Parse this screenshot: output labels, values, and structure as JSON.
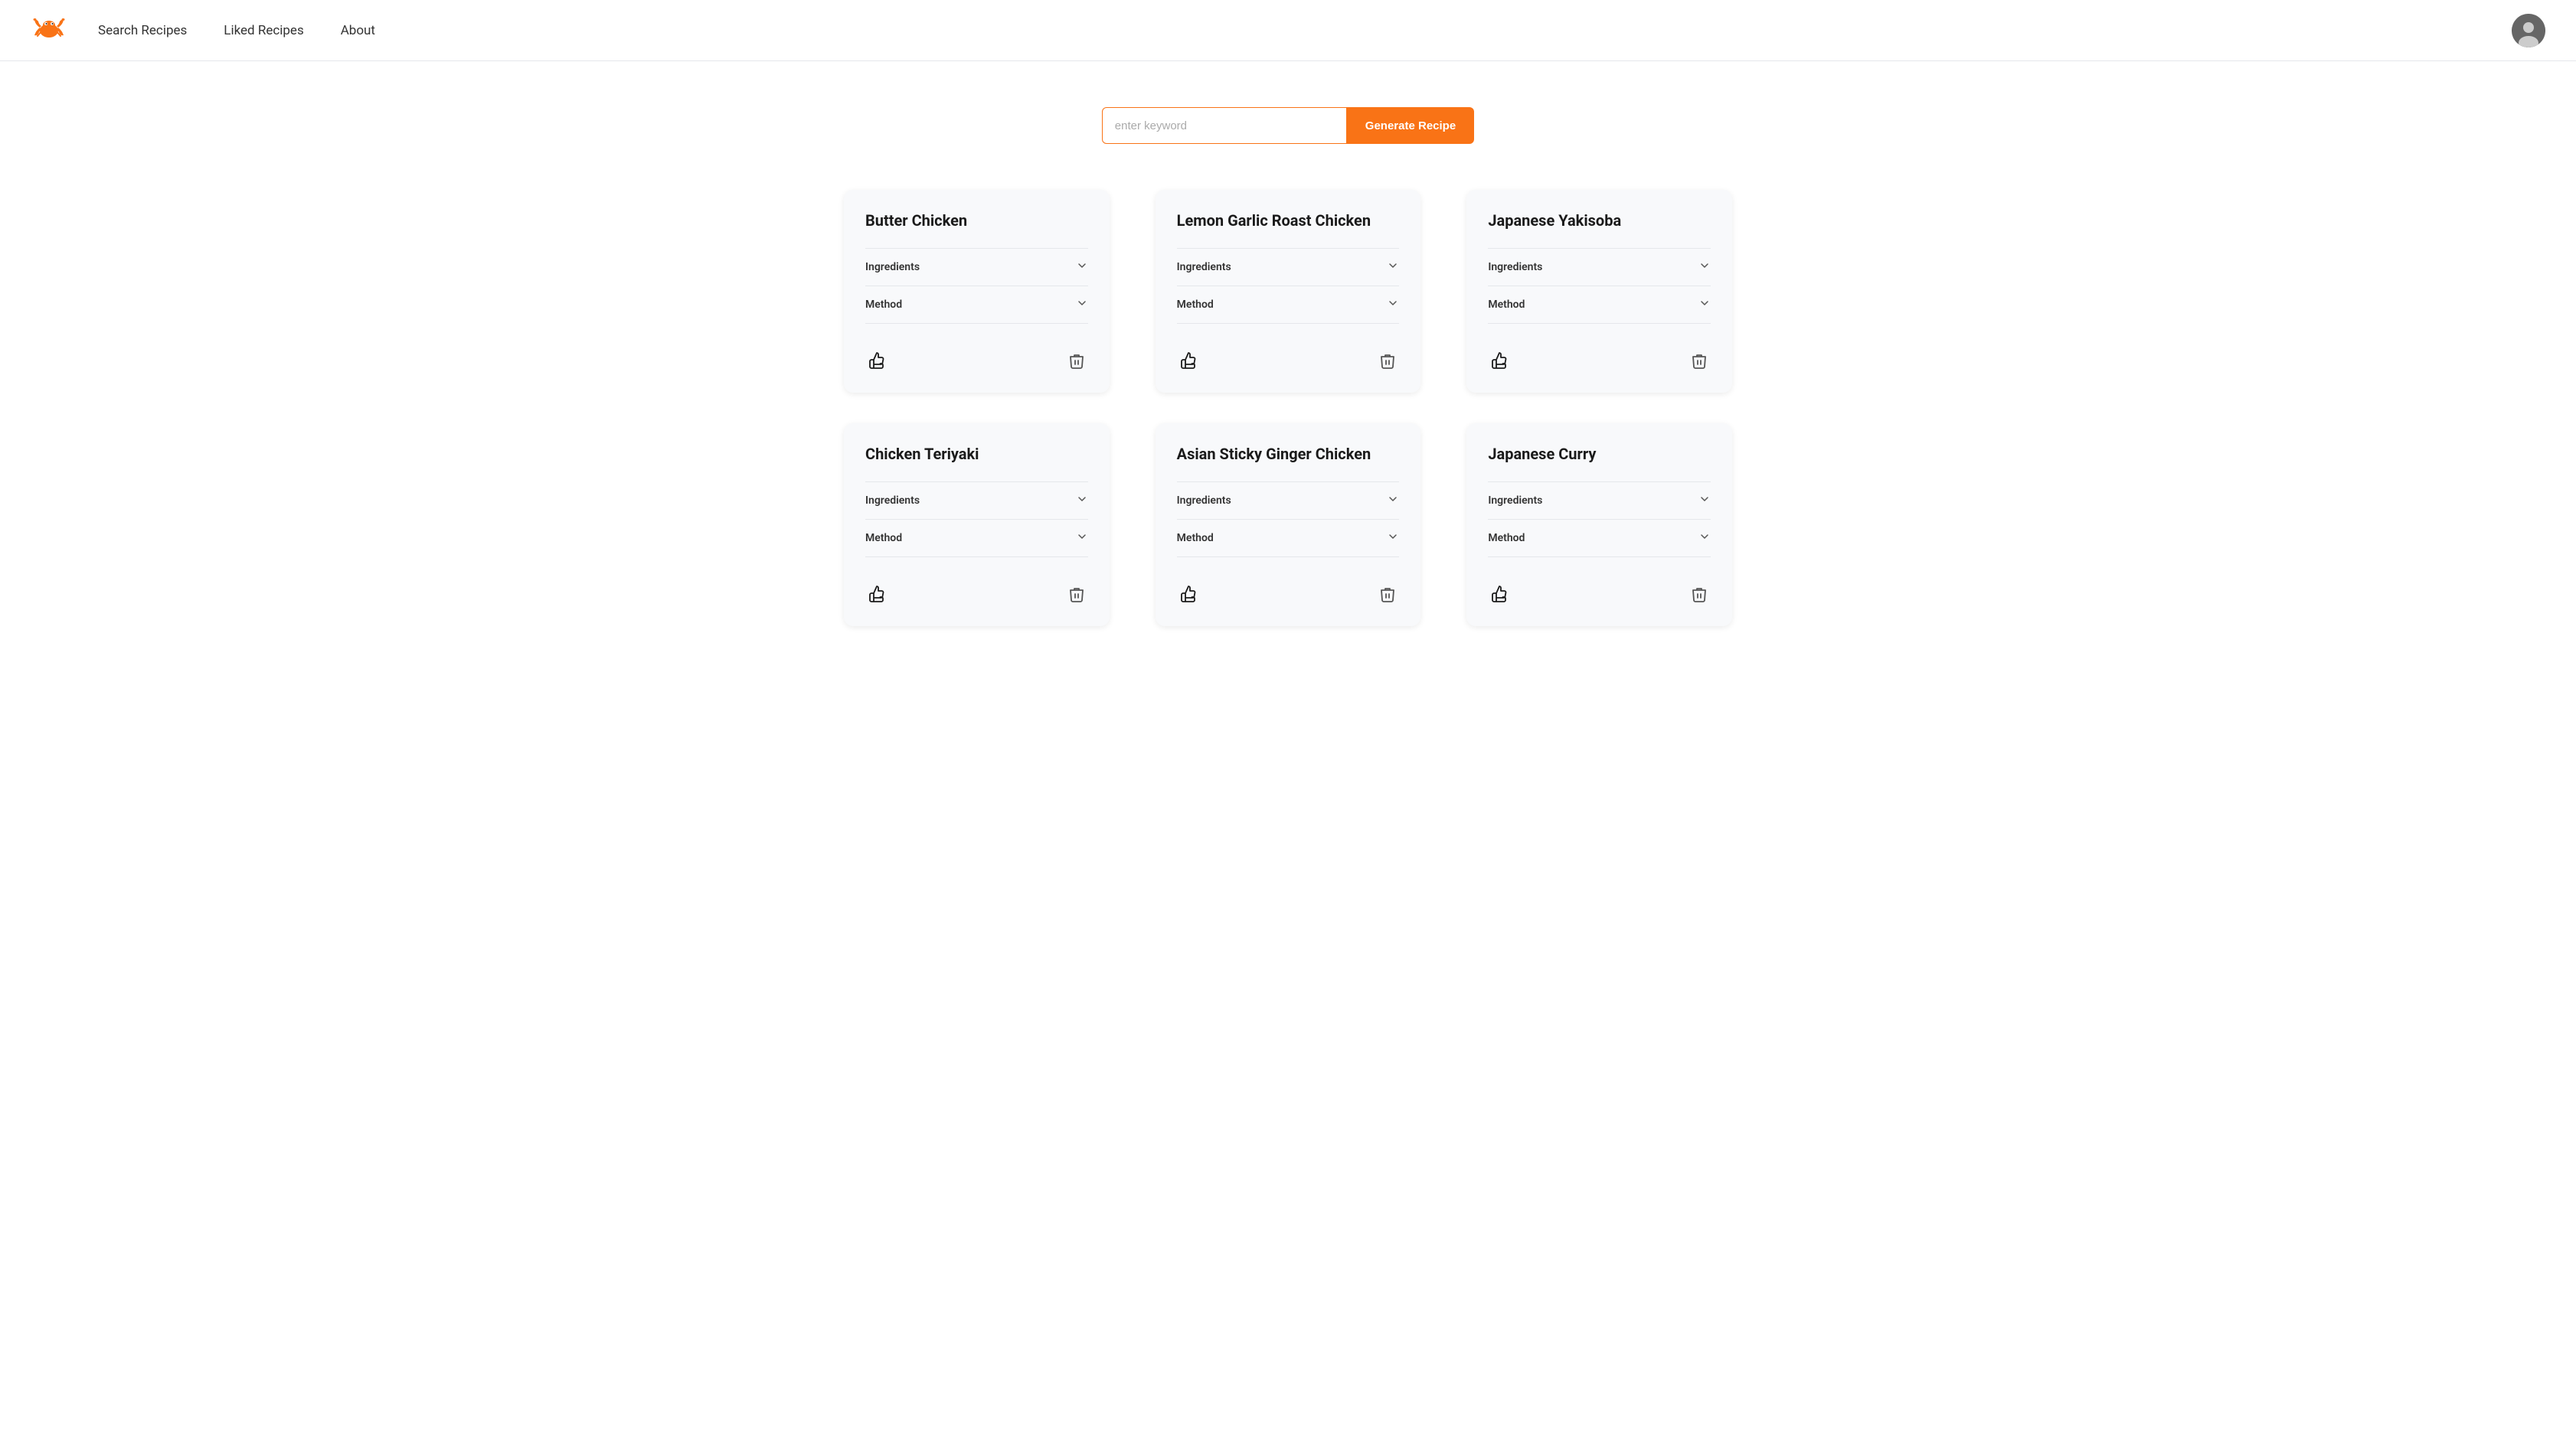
{
  "navbar": {
    "logo_alt": "Crab Logo",
    "links": [
      {
        "label": "Search Recipes",
        "id": "search-recipes"
      },
      {
        "label": "Liked Recipes",
        "id": "liked-recipes"
      },
      {
        "label": "About",
        "id": "about"
      }
    ]
  },
  "search": {
    "placeholder": "enter keyword",
    "button_label": "Generate Recipe"
  },
  "recipes": [
    {
      "id": "butter-chicken",
      "title": "Butter Chicken",
      "sections": [
        {
          "label": "Ingredients"
        },
        {
          "label": "Method"
        }
      ]
    },
    {
      "id": "lemon-garlic-roast-chicken",
      "title": "Lemon Garlic Roast Chicken",
      "sections": [
        {
          "label": "Ingredients"
        },
        {
          "label": "Method"
        }
      ]
    },
    {
      "id": "japanese-yakisoba",
      "title": "Japanese Yakisoba",
      "sections": [
        {
          "label": "Ingredients"
        },
        {
          "label": "Method"
        }
      ]
    },
    {
      "id": "chicken-teriyaki",
      "title": "Chicken Teriyaki",
      "sections": [
        {
          "label": "Ingredients"
        },
        {
          "label": "Method"
        }
      ]
    },
    {
      "id": "asian-sticky-ginger-chicken",
      "title": "Asian Sticky Ginger Chicken",
      "sections": [
        {
          "label": "Ingredients"
        },
        {
          "label": "Method"
        }
      ]
    },
    {
      "id": "japanese-curry",
      "title": "Japanese Curry",
      "sections": [
        {
          "label": "Ingredients"
        },
        {
          "label": "Method"
        }
      ]
    }
  ],
  "icons": {
    "chevron_down": "⌄",
    "thumb_up": "👍",
    "trash": "🗑"
  },
  "colors": {
    "accent": "#f97316",
    "navbar_border": "#e5e7eb"
  }
}
